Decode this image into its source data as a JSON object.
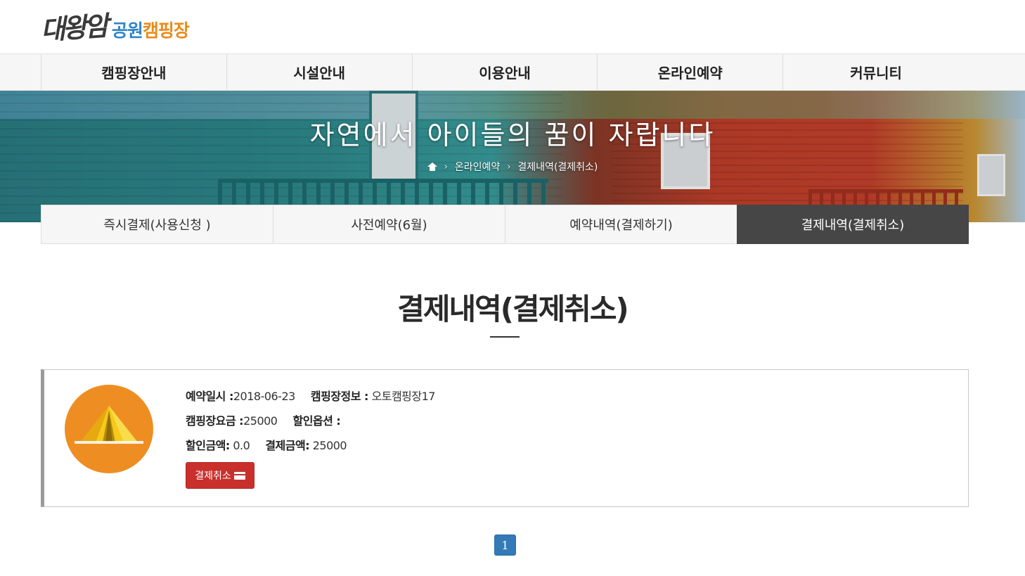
{
  "logo": {
    "part1": "대왕암",
    "part2": "공원",
    "part3": "캠핑장"
  },
  "gnb": {
    "items": [
      {
        "label": "캠핑장안내"
      },
      {
        "label": "시설안내"
      },
      {
        "label": "이용안내"
      },
      {
        "label": "온라인예약"
      },
      {
        "label": "커뮤니티"
      }
    ]
  },
  "hero": {
    "title": "자연에서 아이들의 꿈이 자랍니다",
    "breadcrumb": [
      "온라인예약",
      "결제내역(결제취소)"
    ]
  },
  "subtabs": [
    {
      "label": "즉시결제(사용신청 )",
      "active": false
    },
    {
      "label": "사전예약(6월)",
      "active": false
    },
    {
      "label": "예약내역(결제하기)",
      "active": false
    },
    {
      "label": "결제내역(결제취소)",
      "active": true
    }
  ],
  "page_title": "결제내역(결제취소)",
  "reservation": {
    "date_label": "예약일시 :",
    "date": "2018-06-23",
    "site_label": "캠핑장정보 :",
    "site": "오토캠핑장17",
    "fee_label": "캠핑장요금 :",
    "fee": "25000",
    "discount_option_label": "할인옵션 :",
    "discount_option": "",
    "discount_amount_label": "할인금액:",
    "discount_amount": "0.0",
    "payment_amount_label": "결제금액:",
    "payment_amount": "25000",
    "cancel_button": "결제취소"
  },
  "pagination": {
    "current": "1"
  },
  "colors": {
    "active_tab": "#464646",
    "cancel_button": "#c9302c",
    "pager": "#337ab7",
    "badge": "#ee8e22"
  }
}
